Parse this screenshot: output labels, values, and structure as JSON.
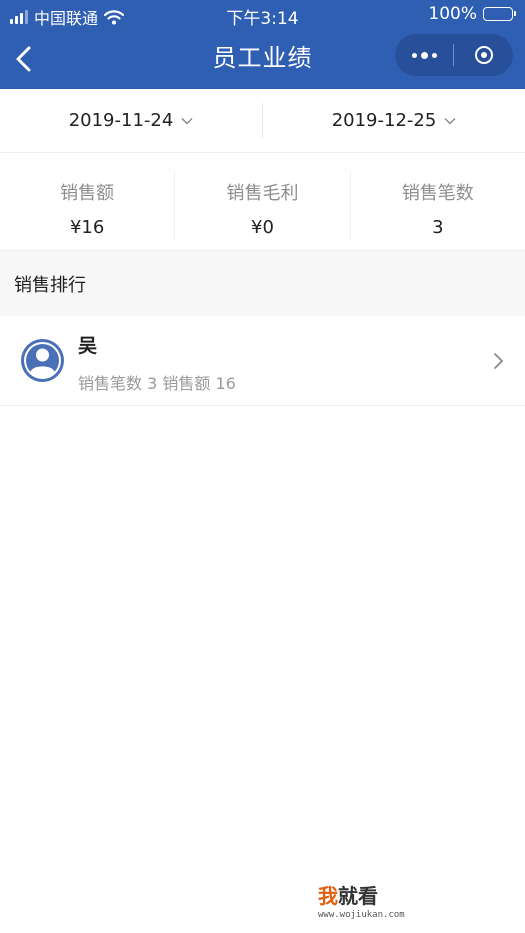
{
  "status_bar": {
    "carrier": "中国联通",
    "time": "下午3:14",
    "battery": "100%"
  },
  "nav": {
    "title": "员工业绩"
  },
  "date_range": {
    "start": "2019-11-24",
    "end": "2019-12-25"
  },
  "stats": [
    {
      "label": "销售额",
      "value": "¥16"
    },
    {
      "label": "销售毛利",
      "value": "¥0"
    },
    {
      "label": "销售笔数",
      "value": "3"
    }
  ],
  "ranking": {
    "title": "销售排行",
    "items": [
      {
        "name": "吴",
        "detail": "销售笔数 3  销售额 16"
      }
    ]
  },
  "watermark": {
    "brand_accent": "我",
    "brand_rest": "就看",
    "url": "www.wojiukan.com"
  },
  "colors": {
    "nav_bg": "#2f5fb3",
    "accent_blue": "#4a70b8"
  }
}
